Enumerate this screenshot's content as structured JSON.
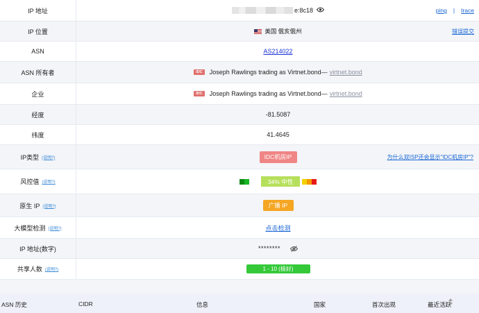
{
  "rows": {
    "ip": {
      "label": "IP 地址",
      "value": "e:8c18",
      "ping": "ping",
      "sep": "|",
      "trace": "trace"
    },
    "location": {
      "label": "IP 位置",
      "value": "美国 俄亥俄州",
      "report": "错误提交"
    },
    "asn": {
      "label": "ASN",
      "value": "AS214022"
    },
    "asn_owner": {
      "label": "ASN 所有者",
      "tag": "IDC",
      "value": "Joseph Rawlings trading as Virtnet.bond—",
      "link": "virtnet.bond"
    },
    "company": {
      "label": "企业",
      "tag": "IDC",
      "value": "Joseph Rawlings trading as Virtnet.bond—",
      "link": "virtnet.bond"
    },
    "longitude": {
      "label": "经度",
      "value": "-81.5087"
    },
    "latitude": {
      "label": "纬度",
      "value": "41.4645"
    },
    "ip_type": {
      "label": "IP类型",
      "help": "(说明?)",
      "value": "IDC机房IP",
      "right_link": "为什么双ISP还会显示\"IDC机房IP\"?"
    },
    "risk": {
      "label": "风控值",
      "help": "(说明?)",
      "value": "34%  中性",
      "level": 0.34
    },
    "native_ip": {
      "label": "原生 IP",
      "help": "(说明?)",
      "value": "广播 IP"
    },
    "llm": {
      "label": "大模型检测",
      "help": "(说明?)",
      "value": "点击检测"
    },
    "ip_numeric": {
      "label": "IP 地址(数字)",
      "value": "********"
    },
    "shared": {
      "label": "共享人数",
      "help": "(说明?)",
      "value": "1 - 10 (极好)"
    }
  },
  "history_header": {
    "asn_history": "ASN 历史",
    "cidr": "CIDR",
    "info": "信息",
    "country": "国家",
    "first_seen": "首次出现",
    "last_active": "最近活跃"
  },
  "colors": {
    "idc_red": "#e0706e",
    "ip_type_bg": "#ef8584",
    "risk_green": "#b6df5c",
    "native_orange": "#f5a623",
    "shared_green": "#35c93a",
    "link_blue": "#1a32d4"
  },
  "icons": [
    "eye-icon",
    "us-flag-icon",
    "eye-off-icon",
    "sort-icon"
  ]
}
